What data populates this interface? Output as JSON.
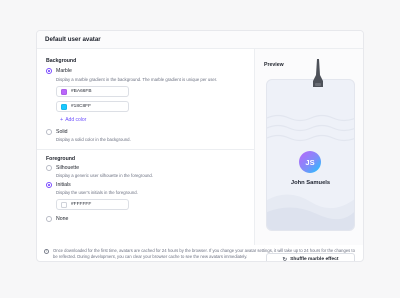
{
  "card": {
    "title": "Default user avatar"
  },
  "background": {
    "title": "Background",
    "marble": {
      "label": "Marble",
      "description": "Display a marble gradient in the background. The marble gradient is unique per user.",
      "colors": [
        {
          "value": "#BA66FB",
          "swatch": "#BA66FB"
        },
        {
          "value": "#18C8FF",
          "swatch": "#18C8FF"
        }
      ],
      "add_color": "Add color"
    },
    "solid": {
      "label": "Solid",
      "description": "Display a solid color in the background."
    }
  },
  "foreground": {
    "title": "Foreground",
    "silhouette": {
      "label": "Silhouette",
      "description": "Display a generic user silhouette in the foreground."
    },
    "initials": {
      "label": "Initials",
      "description": "Display the user's initials in the foreground.",
      "color": {
        "value": "#FFFFFF",
        "swatch": "#FFFFFF"
      }
    },
    "none": {
      "label": "None"
    }
  },
  "preview": {
    "title": "Preview",
    "initials": "JS",
    "name": "John Samuels",
    "shuffle_label": "Shuffle marble effect"
  },
  "footer": {
    "note": "Once downloaded for the first time, avatars are cached for 24 hours by the browser. If you change your avatar settings, it will take up to 24 hours for the changes to be reflected. During development, you can clear your browser cache to see the new avatars immediately."
  },
  "colors": {
    "accent": "#7C4DFF",
    "link": "#6B4DFF"
  }
}
